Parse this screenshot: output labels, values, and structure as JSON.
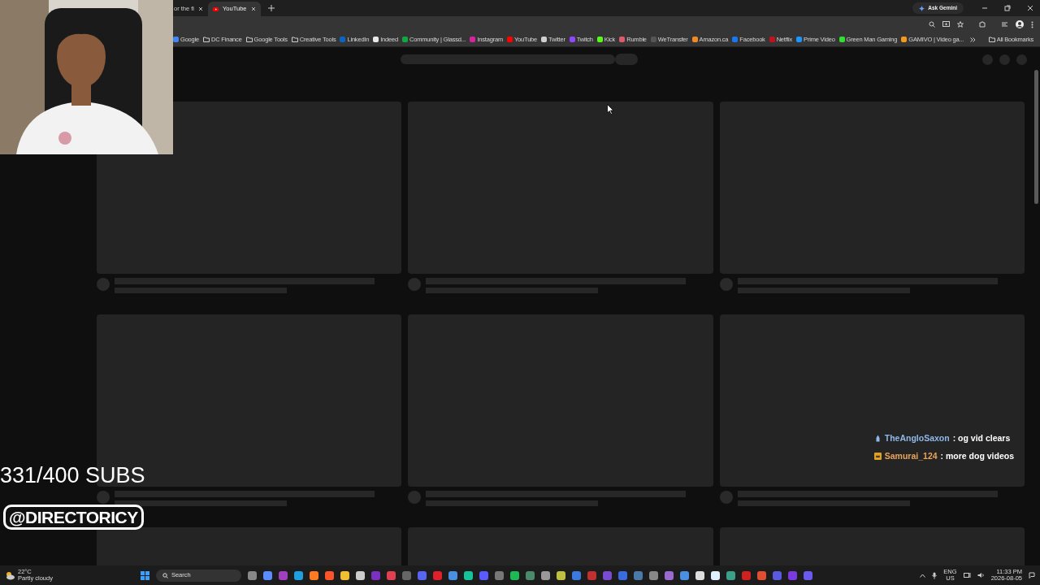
{
  "tabs": [
    {
      "label": "or the fi",
      "selected": false
    },
    {
      "label": "YouTube",
      "selected": true
    }
  ],
  "ask_gemini": "Ask Gemini",
  "bookmarks": [
    {
      "label": "Google",
      "kind": "site",
      "color": "#4285f4"
    },
    {
      "label": "DC Finance",
      "kind": "folder"
    },
    {
      "label": "Google Tools",
      "kind": "folder"
    },
    {
      "label": "Creative Tools",
      "kind": "folder"
    },
    {
      "label": "LinkedIn",
      "kind": "site",
      "color": "#0a66c2"
    },
    {
      "label": "Indeed",
      "kind": "site",
      "color": "#e8e8e8"
    },
    {
      "label": "Community | Glassd...",
      "kind": "site",
      "color": "#0caa41"
    },
    {
      "label": "Instagram",
      "kind": "site",
      "color": "#d6249f"
    },
    {
      "label": "YouTube",
      "kind": "site",
      "color": "#ff0000"
    },
    {
      "label": "Twitter",
      "kind": "site",
      "color": "#d0d0d0"
    },
    {
      "label": "Twitch",
      "kind": "site",
      "color": "#9146ff"
    },
    {
      "label": "Kick",
      "kind": "site",
      "color": "#53fc18"
    },
    {
      "label": "Rumble",
      "kind": "site",
      "color": "#e05a6a"
    },
    {
      "label": "WeTransfer",
      "kind": "site",
      "color": "#555555"
    },
    {
      "label": "Amazon.ca",
      "kind": "site",
      "color": "#f08a24"
    },
    {
      "label": "Facebook",
      "kind": "site",
      "color": "#1877f2"
    },
    {
      "label": "Netflix",
      "kind": "site",
      "color": "#c1121f"
    },
    {
      "label": "Prime Video",
      "kind": "site",
      "color": "#1a98ff"
    },
    {
      "label": "Green Man Gaming",
      "kind": "site",
      "color": "#2fe02f"
    },
    {
      "label": "GAMIVO | Video ga...",
      "kind": "site",
      "color": "#f39a1e"
    }
  ],
  "all_bookmarks": "All Bookmarks",
  "video_grid": [
    {
      "kind": "skeleton"
    },
    {
      "kind": "skeleton"
    },
    {
      "kind": "skeleton"
    },
    {
      "kind": "skeleton"
    },
    {
      "kind": "skeleton"
    },
    {
      "kind": "skeleton"
    },
    {
      "kind": "thumbnail_only"
    },
    {
      "kind": "thumbnail_only"
    },
    {
      "kind": "thumbnail_only"
    }
  ],
  "overlay": {
    "subs": "331/400 SUBS",
    "handle": "@DIRECTORICY"
  },
  "chat": [
    {
      "user": "TheAngloSaxon",
      "message": ": og vid clears",
      "color": "#8fb8e8"
    },
    {
      "user": "Samurai_124",
      "message": ": more dog videos",
      "color": "#e8a45a"
    }
  ],
  "taskbar": {
    "temperature": "22°C",
    "weather": "Partly cloudy",
    "search_placeholder": "Search",
    "language": "ENG",
    "region": "US",
    "time": "11:33 PM",
    "date": "2026-08-05"
  }
}
